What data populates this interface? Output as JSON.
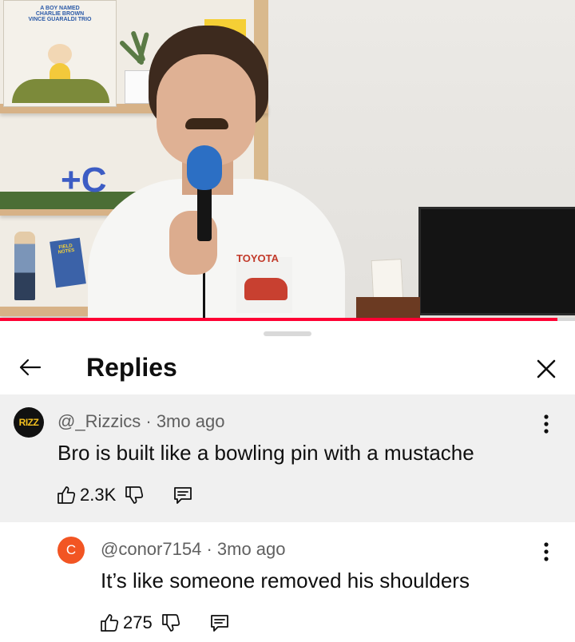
{
  "video": {
    "record_title": "A BOY NAMED CHARLIE BROWN VINCE GUARALDI TRIO",
    "shirt_brand": "TOYOTA",
    "field_notes": "FIELD NOTES",
    "progress_fraction": 0.97,
    "progress_color": "#ff0033"
  },
  "sheet": {
    "title": "Replies",
    "back_icon": "arrow-left-icon",
    "close_icon": "close-icon"
  },
  "comments": [
    {
      "avatar_text": "RIZZ",
      "author": "@_Rizzics",
      "separator": "·",
      "time": "3mo ago",
      "text": "Bro is built like a bowling pin with a mustache",
      "likes": "2.3K"
    },
    {
      "avatar_text": "C",
      "author": "@conor7154",
      "separator": "·",
      "time": "3mo ago",
      "text": "It’s like someone removed his shoulders",
      "likes": "275"
    }
  ],
  "colors": {
    "highlight_bg": "#f0f0f0",
    "avatar_c": "#f25523",
    "meta": "#606060"
  }
}
